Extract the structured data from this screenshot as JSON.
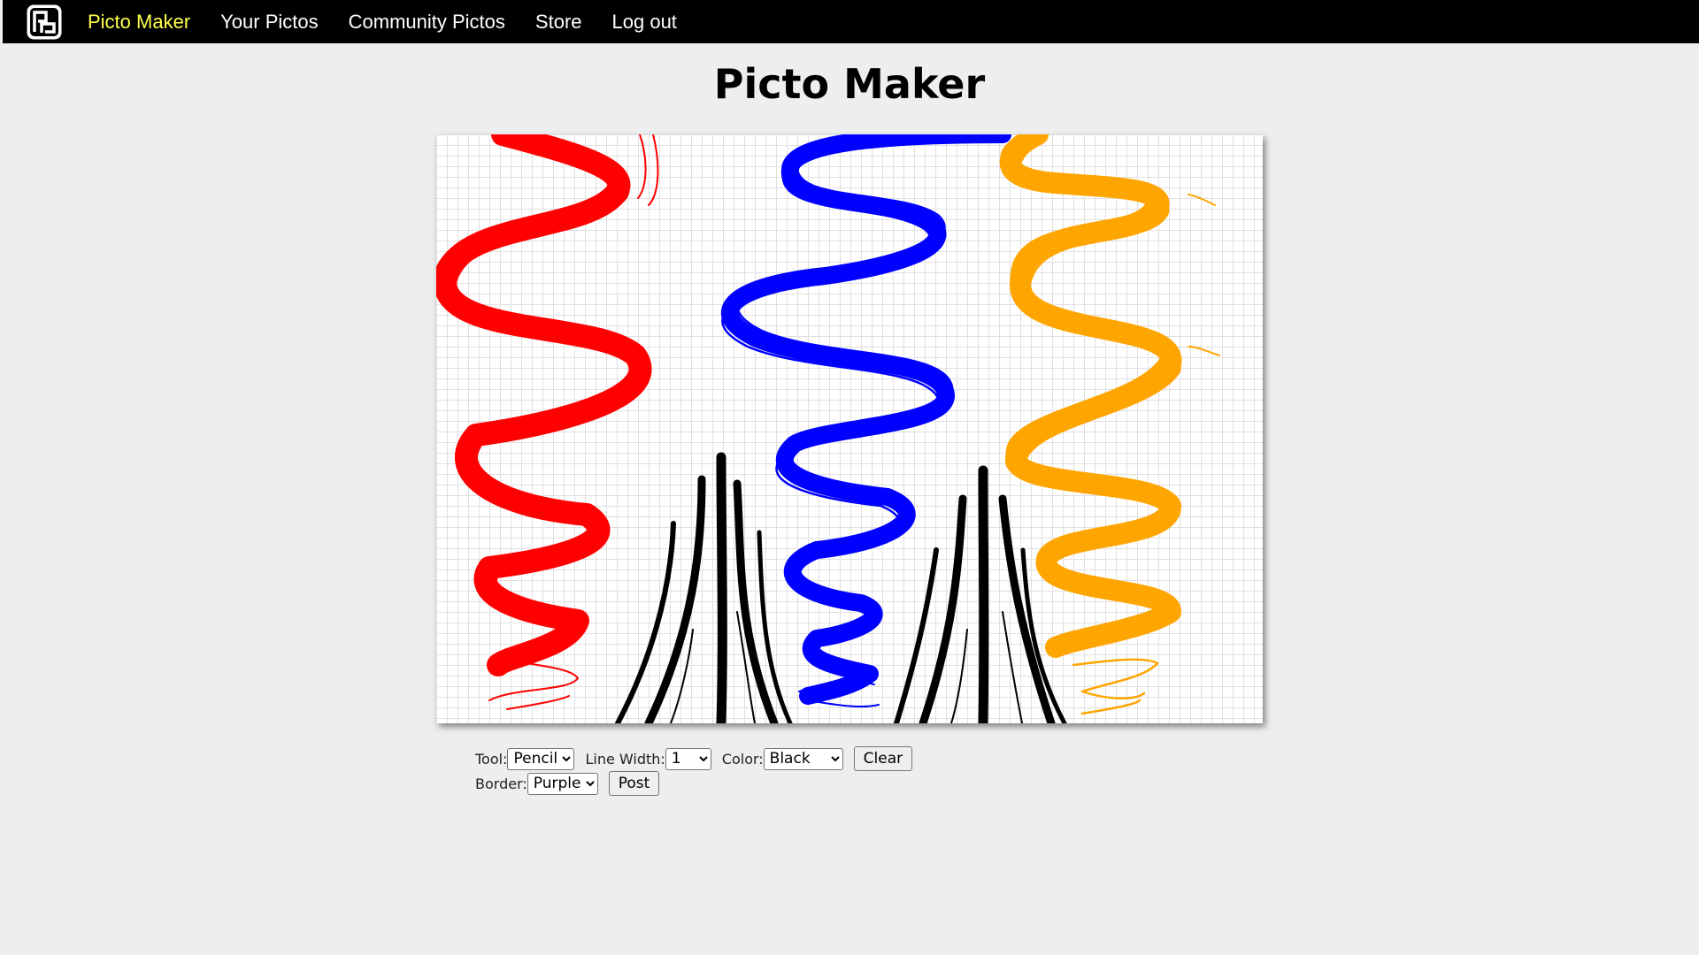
{
  "nav": {
    "logo_icon": "picto-logo-icon",
    "items": [
      {
        "label": "Picto Maker",
        "active": true
      },
      {
        "label": "Your Pictos",
        "active": false
      },
      {
        "label": "Community Pictos",
        "active": false
      },
      {
        "label": "Store",
        "active": false
      },
      {
        "label": "Log out",
        "active": false
      }
    ],
    "active_color": "#ffff4d"
  },
  "page": {
    "title": "Picto Maker"
  },
  "canvas": {
    "strokes": [
      {
        "color": "#ff0000",
        "kind": "wavy-ribbon"
      },
      {
        "color": "#0000ff",
        "kind": "wavy-ribbon"
      },
      {
        "color": "#ffa500",
        "kind": "wavy-ribbon"
      },
      {
        "color": "#000000",
        "kind": "vertical-lines"
      }
    ]
  },
  "controls": {
    "tool_label": "Tool:",
    "tool_value": "Pencil",
    "line_width_label": "Line Width:",
    "line_width_value": "1",
    "color_label": "Color:",
    "color_value": "Black",
    "clear_label": "Clear",
    "border_label": "Border:",
    "border_value": "Purple",
    "post_label": "Post"
  }
}
